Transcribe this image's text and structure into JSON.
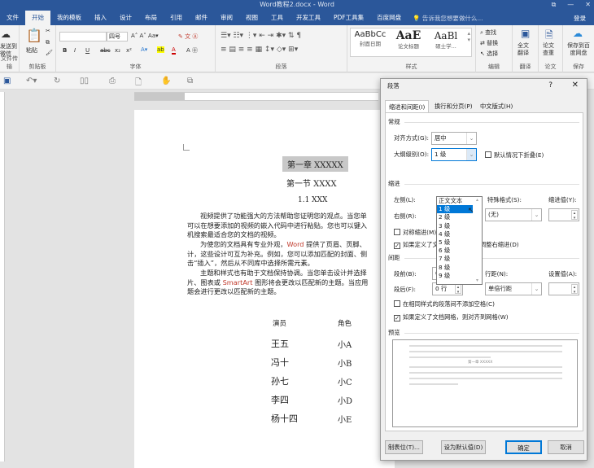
{
  "window": {
    "title": "Word教程2.docx - Word",
    "controls": [
      "⧉",
      "—",
      "✕"
    ]
  },
  "tabs": [
    "文件",
    "开始",
    "我的模板",
    "插入",
    "设计",
    "布局",
    "引用",
    "邮件",
    "审阅",
    "视图",
    "工具",
    "开发工具",
    "PDF工具集",
    "百度网盘"
  ],
  "active_tab": "开始",
  "tell_me": "告诉我您想要做什么...",
  "login": "登录",
  "ribbon": {
    "send": {
      "label": "发送到微信",
      "group": "文件传输"
    },
    "clipboard": {
      "paste": "粘贴",
      "group": "剪贴板"
    },
    "font": {
      "size": "四号",
      "group": "字体",
      "buttons": [
        "B",
        "I",
        "U",
        "abc",
        "x₂",
        "x²"
      ]
    },
    "paragraph": {
      "group": "段落"
    },
    "styles": {
      "group": "样式",
      "items": [
        {
          "sample": "AaBbCc",
          "name": "封面日期"
        },
        {
          "sample": "AaE",
          "name": "论文标题"
        },
        {
          "sample": "AaBl",
          "name": "硕士学..."
        }
      ]
    },
    "editing": {
      "group": "编辑",
      "find": "查找",
      "replace": "替换",
      "select": "选择"
    },
    "translate": {
      "label": "全文翻译",
      "group": "翻译"
    },
    "thesis": {
      "label": "论文查重",
      "group": "论文"
    },
    "save": {
      "label": "保存到百度网盘",
      "group": "保存"
    }
  },
  "document": {
    "chapter": "第一章  XXXXX",
    "section": "第一节  XXXX",
    "subsection": "1.1 XXX",
    "paragraphs": [
      [
        "视频提供了功能强大的方法帮助您证明您的观点。当您单",
        "可以在想要添加的视频的嵌入代码中进行粘贴。您也可以键入",
        "机搜索最适合您的文档的视频。"
      ],
      [
        "为使您的文档具有专业外观，",
        "Word",
        "提供了页眉、页脚、",
        "计，这些设计可互为补充。例如，您可以添加匹配的封面、侧",
        "击“插入”，然后从不同库中选择所需元素。"
      ],
      [
        "主题和样式也有助于文档保持协调。当您单击设计并选择",
        "片、图表或",
        "SmartArt",
        "图形将会更改以匹配新的主题。当应用",
        "题会进行更改以匹配新的主题。"
      ]
    ],
    "table": {
      "headers": [
        "演员",
        "角色"
      ],
      "rows": [
        [
          "王五",
          "小A"
        ],
        [
          "冯十",
          "小B"
        ],
        [
          "孙七",
          "小C"
        ],
        [
          "李四",
          "小D"
        ],
        [
          "杨十四",
          "小E"
        ]
      ]
    }
  },
  "dialog": {
    "title": "段落",
    "help": "?",
    "close": "✕",
    "tabs": [
      "缩进和间距(I)",
      "换行和分页(P)",
      "中文版式(H)"
    ],
    "general": "常规",
    "alignment_label": "对齐方式(G):",
    "alignment_value": "居中",
    "outline_label": "大纲级别(O):",
    "outline_value": "1 级",
    "collapse_label": "默认情况下折叠(E)",
    "outline_options": [
      "正文文本",
      "1 级",
      "2 级",
      "3 级",
      "4 级",
      "5 级",
      "6 级",
      "7 级",
      "8 级",
      "9 级"
    ],
    "outline_highlighted": "1 级",
    "indent": "缩进",
    "left_label": "左侧(L):",
    "right_label": "右侧(R):",
    "special_label": "特殊格式(S):",
    "special_value": "(无)",
    "indent_value_label": "缩进值(Y):",
    "mirror_label": "对称缩进(M)",
    "grid_indent_label": "如果定义了文档网格，则自动调整右缩进(D)",
    "spacing": "间距",
    "before_label": "段前(B):",
    "before_value": "0 行",
    "after_label": "段后(F):",
    "after_value": "0 行",
    "line_label": "行距(N):",
    "line_value": "单倍行距",
    "at_label": "设置值(A):",
    "no_space_label": "在相同样式的段落间不添加空格(C)",
    "snap_label": "如果定义了文档网格，则对齐到网格(W)",
    "preview": "预览",
    "preview_heading": "第一章 XXXXX",
    "buttons": {
      "tabs": "制表位(T)...",
      "default": "设为默认值(D)",
      "ok": "确定",
      "cancel": "取消"
    }
  },
  "colors": {
    "accent": "#2b579a",
    "highlight": "#0078d7"
  }
}
